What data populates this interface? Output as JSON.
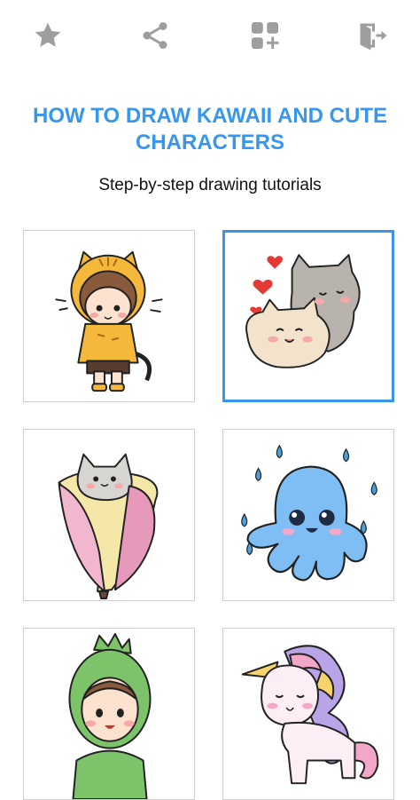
{
  "toolbar": {
    "icons": [
      "star-icon",
      "share-icon",
      "more-apps-icon",
      "exit-icon"
    ],
    "icon_color": "#9e9e9e"
  },
  "header": {
    "title": "HOW TO DRAW KAWAII AND CUTE CHARACTERS",
    "subtitle": "Step-by-step drawing tutorials"
  },
  "colors": {
    "accent": "#3797ef",
    "card_border": "#cfcfcf"
  },
  "tutorials": [
    {
      "character": "girl-in-tiger-hoodie",
      "selected": false
    },
    {
      "character": "two-cuddling-cats-with-hearts",
      "selected": true
    },
    {
      "character": "cat-in-banana",
      "selected": false
    },
    {
      "character": "octopus-with-raindrops",
      "selected": false
    },
    {
      "character": "kid-in-dinosaur-costume",
      "selected": false
    },
    {
      "character": "rainbow-unicorn",
      "selected": false
    }
  ]
}
